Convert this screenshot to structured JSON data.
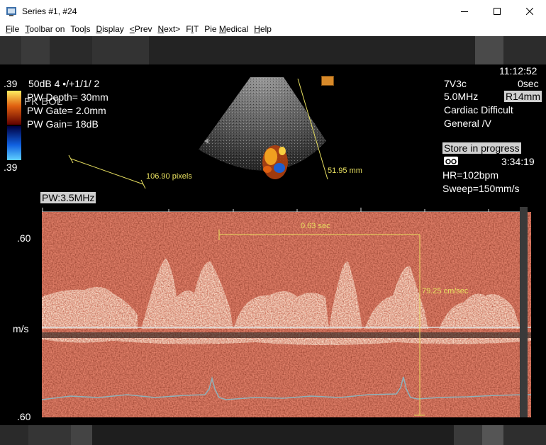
{
  "window": {
    "title": "Series #1, #24"
  },
  "menu": [
    {
      "label": "File",
      "ul": "F",
      "rest": "ile"
    },
    {
      "label": "Toolbar on",
      "ul": "T",
      "rest": "oolbar on"
    },
    {
      "label": "Tools",
      "pre": "Too",
      "ul": "l",
      "rest": "s"
    },
    {
      "label": "Display",
      "ul": "D",
      "rest": "isplay"
    },
    {
      "label": "<Prev",
      "ul": "<",
      "rest": "Prev"
    },
    {
      "label": "Next>",
      "ul": "N",
      "rest": "ext>"
    },
    {
      "label": "FIT",
      "pre": "F",
      "ul": "I",
      "rest": "T"
    },
    {
      "label": "Pie Medical",
      "pre": "Pie ",
      "ul": "M",
      "rest": "edical"
    },
    {
      "label": "Help",
      "ul": "H",
      "rest": "elp"
    }
  ],
  "overlay": {
    "top_left": {
      "scale_top": ".39",
      "params": "50dB   4 •/+1/1/ 2",
      "pw_depth": "PW Depth=  30mm",
      "pw_gate": "PW Gate=  2.0mm",
      "pw_gain": "PW Gain=  18dB",
      "pk_bol": "PK BOL",
      "scale_bottom": ".39"
    },
    "top_right": {
      "time": "11:12:52",
      "probe": "7V3c",
      "elapsed": "0sec",
      "freq": "5.0MHz",
      "preset_code": "R14mm",
      "preset": "Cardiac Difficult",
      "mode": "General /V",
      "store_status": "Store in progress",
      "clip_time": "3:34:19",
      "hr": "HR=102bpm",
      "sweep": "Sweep=150mm/s"
    },
    "pw_freq": "PW:3.5MHz",
    "y_axis": {
      "top": ".60",
      "unit": "m/s",
      "bottom": ".60"
    },
    "measurements": {
      "distance_px": "106.90 pixels",
      "depth_mm": "51.95 mm",
      "time_sec": "0.63 sec",
      "velocity": "79.25 cm/sec"
    }
  },
  "colors": {
    "doppler_bg": "#7a2418",
    "signal": "#ffe0c0",
    "measure": "#e8e060",
    "ecg": "#8fb0b8"
  },
  "icons": {
    "app": "ultrasound-app-icon",
    "minimize": "minimize-icon",
    "maximize": "maximize-icon",
    "close": "close-icon",
    "tape": "tape-recorder-icon"
  }
}
